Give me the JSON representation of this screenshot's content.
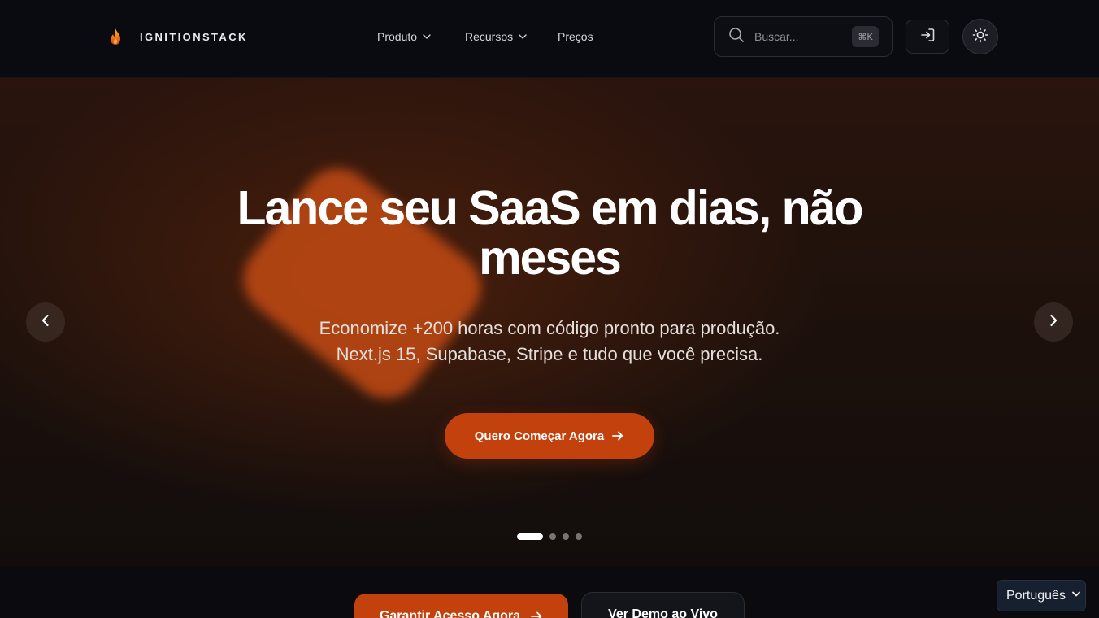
{
  "header": {
    "brand": "IGNITIONSTACK",
    "nav": [
      {
        "label": "Produto",
        "has_dropdown": true
      },
      {
        "label": "Recursos",
        "has_dropdown": true
      },
      {
        "label": "Preços",
        "has_dropdown": false
      }
    ],
    "search": {
      "placeholder": "Buscar...",
      "shortcut": "⌘K"
    },
    "icons": {
      "logo": "flame-icon",
      "search": "search-icon",
      "login": "sign-in-icon",
      "theme": "sun-icon"
    }
  },
  "hero": {
    "title": "Lance seu SaaS em dias, não meses",
    "subtitle_line1": "Economize +200 horas com código pronto para produção.",
    "subtitle_line2": "Next.js 15, Supabase, Stripe e tudo que você precisa.",
    "cta_label": "Quero Começar Agora",
    "carousel": {
      "slides": 4,
      "active_slide": 1
    }
  },
  "actions": {
    "primary_label": "Garantir Acesso Agora",
    "secondary_label": "Ver Demo ao Vivo"
  },
  "language": {
    "selected": "Português"
  },
  "colors": {
    "accent": "#c2410c",
    "flame_top": "#f97316",
    "header_bg": "#0a0b10",
    "page_bg": "#0b0b0f"
  }
}
